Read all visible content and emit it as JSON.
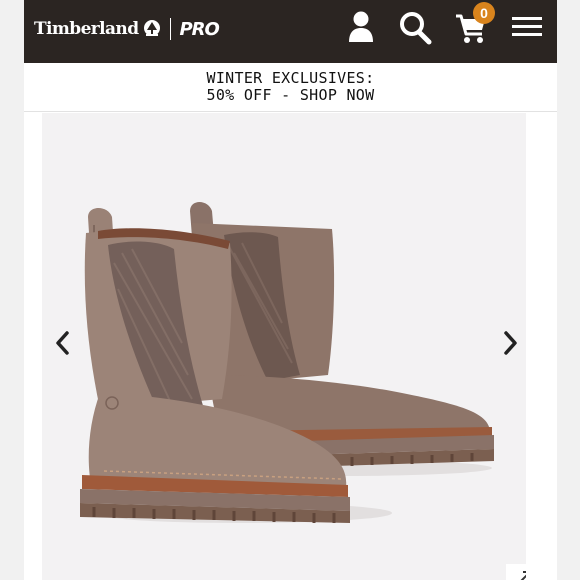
{
  "header": {
    "brand": "Timberland",
    "pro": "PRO",
    "cart_count": "0",
    "icons": [
      "tree-logo-icon",
      "user-icon",
      "search-icon",
      "cart-icon",
      "hamburger-menu-icon"
    ],
    "background": "#2b2522",
    "badge_color": "#d9841d"
  },
  "promo": {
    "line1": "WINTER EXCLUSIVES:",
    "line2": "50% OFF - SHOP NOW"
  },
  "gallery": {
    "image": "taupe-chelsea-boots",
    "prev_icon": "chevron-left-icon",
    "next_icon": "chevron-right-icon",
    "expand_icon": "expand-icon"
  }
}
